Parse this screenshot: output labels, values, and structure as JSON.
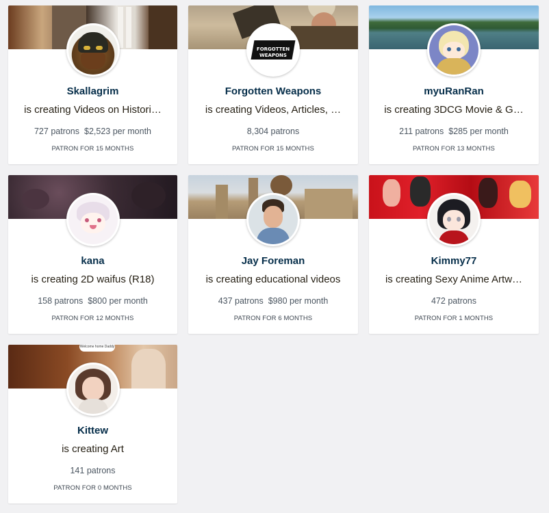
{
  "creators": [
    {
      "name": "Skallagrim",
      "creating": "is creating Videos on Histori…",
      "patrons": "727 patrons",
      "per_month": "$2,523 per month",
      "patron_for": "PATRON FOR 15 MONTHS",
      "avatar_icon": "helmet-avatar-icon"
    },
    {
      "name": "Forgotten Weapons",
      "creating": "is creating Videos, Articles, …",
      "patrons": "8,304 patrons",
      "per_month": "",
      "patron_for": "PATRON FOR 15 MONTHS",
      "avatar_icon": "forgotten-weapons-logo-icon",
      "avatar_text": "FORGOTTEN WEAPONS"
    },
    {
      "name": "myuRanRan",
      "creating": "is creating 3DCG Movie & G…",
      "patrons": "211 patrons",
      "per_month": "$285 per month",
      "patron_for": "PATRON FOR 13 MONTHS",
      "avatar_icon": "anime-girl-avatar-icon"
    },
    {
      "name": "kana",
      "creating": "is creating 2D waifus (R18)",
      "patrons": "158 patrons",
      "per_month": "$800 per month",
      "patron_for": "PATRON FOR 12 MONTHS",
      "avatar_icon": "chibi-avatar-icon"
    },
    {
      "name": "Jay Foreman",
      "creating": "is creating educational videos",
      "patrons": "437 patrons",
      "per_month": "$980 per month",
      "patron_for": "PATRON FOR 6 MONTHS",
      "avatar_icon": "person-avatar-icon"
    },
    {
      "name": "Kimmy77",
      "creating": "is creating Sexy Anime Artw…",
      "patrons": "472 patrons",
      "per_month": "",
      "patron_for": "PATRON FOR 1 MONTHS",
      "avatar_icon": "anime-avatar-icon"
    },
    {
      "name": "Kittew",
      "creating": "is creating Art",
      "patrons": "141 patrons",
      "per_month": "",
      "patron_for": "PATRON FOR 0 MONTHS",
      "avatar_icon": "person-avatar-icon",
      "banner_bubble_text": "Welcome home Daddy"
    }
  ],
  "colors": {
    "page_background": "#f1f1f3",
    "card_background": "#ffffff",
    "name_color": "#052d49",
    "text_color": "#241e12",
    "stats_color": "#4a5560"
  }
}
